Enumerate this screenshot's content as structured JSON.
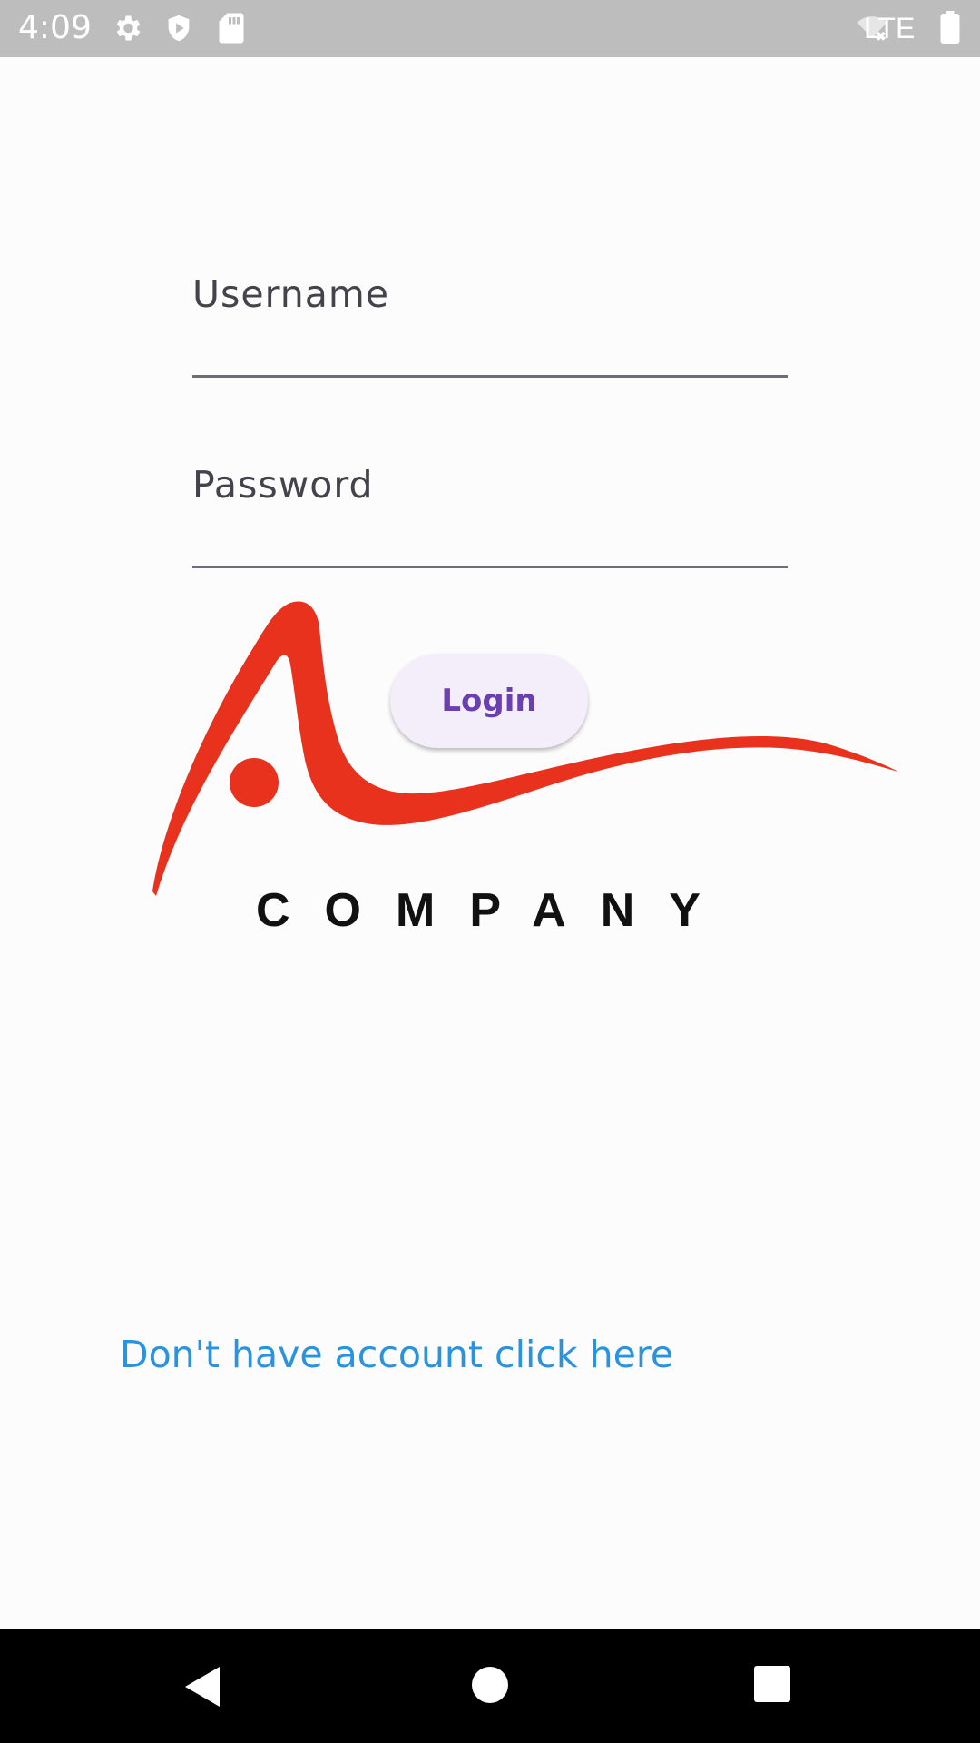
{
  "status_bar": {
    "time": "4:09",
    "network": "LTE",
    "icons": [
      "gear-icon",
      "shield-play-icon",
      "sd-card-icon",
      "wifi-off-icon",
      "battery-icon"
    ]
  },
  "form": {
    "username_label": "Username",
    "password_label": "Password",
    "login_label": "Login"
  },
  "logo": {
    "text": "COMPANY",
    "accent_color": "#e8321e"
  },
  "signup_link": "Don't have account click here",
  "nav_bar": {
    "icons": [
      "back-icon",
      "home-icon",
      "recents-icon"
    ]
  },
  "colors": {
    "status_bar": "#bdbdbd",
    "button_text": "#6a3fb0",
    "button_bg": "#f4eefa",
    "link": "#2a93e0"
  }
}
